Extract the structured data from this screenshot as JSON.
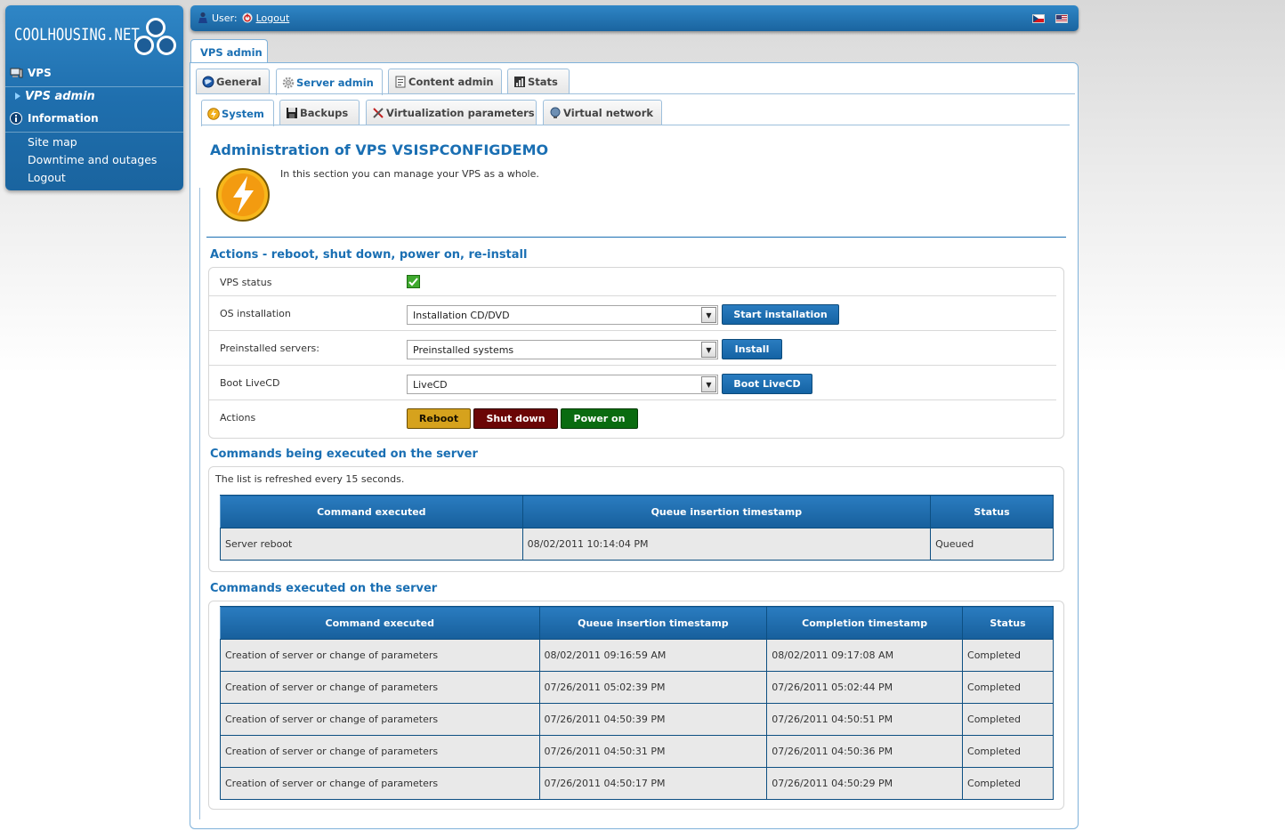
{
  "sidebar": {
    "logo_text": "COOLHOUSING.NET",
    "items": [
      {
        "label": "VPS"
      },
      {
        "label": "VPS admin"
      },
      {
        "label": "Information"
      }
    ],
    "links": [
      {
        "label": "Site map"
      },
      {
        "label": "Downtime and outages"
      },
      {
        "label": "Logout"
      }
    ]
  },
  "topbar": {
    "user_label": "User:",
    "logout_label": "Logout"
  },
  "main_tab": "VPS admin",
  "tabs": [
    {
      "label": "General"
    },
    {
      "label": "Server admin"
    },
    {
      "label": "Content admin"
    },
    {
      "label": "Stats"
    }
  ],
  "subtabs": [
    {
      "label": "System"
    },
    {
      "label": "Backups"
    },
    {
      "label": "Virtualization parameters"
    },
    {
      "label": "Virtual network"
    }
  ],
  "page": {
    "title": "Administration of VPS VSISPCONFIGDEMO",
    "intro": "In this section you can manage your VPS as a whole."
  },
  "actions": {
    "heading": "Actions - reboot, shut down, power on, re-install",
    "rows": {
      "status_label": "VPS status",
      "os_label": "OS installation",
      "os_value": "Installation CD/DVD",
      "os_button": "Start installation",
      "pre_label": "Preinstalled servers:",
      "pre_value": "Preinstalled systems",
      "pre_button": "Install",
      "live_label": "Boot LiveCD",
      "live_value": "LiveCD",
      "live_button": "Boot LiveCD",
      "actions_label": "Actions",
      "reboot": "Reboot",
      "shutdown": "Shut down",
      "poweron": "Power on"
    }
  },
  "running": {
    "heading": "Commands being executed on the server",
    "note": "The list is refreshed every 15 seconds.",
    "headers": [
      "Command executed",
      "Queue insertion timestamp",
      "Status"
    ],
    "rows": [
      [
        "Server reboot",
        "08/02/2011 10:14:04 PM",
        "Queued"
      ]
    ]
  },
  "executed": {
    "heading": "Commands executed on the server",
    "headers": [
      "Command executed",
      "Queue insertion timestamp",
      "Completion timestamp",
      "Status"
    ],
    "rows": [
      [
        "Creation of server or change of parameters",
        "08/02/2011 09:16:59 AM",
        "08/02/2011 09:17:08 AM",
        "Completed"
      ],
      [
        "Creation of server or change of parameters",
        "07/26/2011 05:02:39 PM",
        "07/26/2011 05:02:44 PM",
        "Completed"
      ],
      [
        "Creation of server or change of parameters",
        "07/26/2011 04:50:39 PM",
        "07/26/2011 04:50:51 PM",
        "Completed"
      ],
      [
        "Creation of server or change of parameters",
        "07/26/2011 04:50:31 PM",
        "07/26/2011 04:50:36 PM",
        "Completed"
      ],
      [
        "Creation of server or change of parameters",
        "07/26/2011 04:50:17 PM",
        "07/26/2011 04:50:29 PM",
        "Completed"
      ]
    ]
  },
  "colors": {
    "brand_blue": "#1f6fae",
    "reboot": "#d6a21d",
    "shutdown": "#6b0606",
    "poweron": "#0a6b10"
  }
}
